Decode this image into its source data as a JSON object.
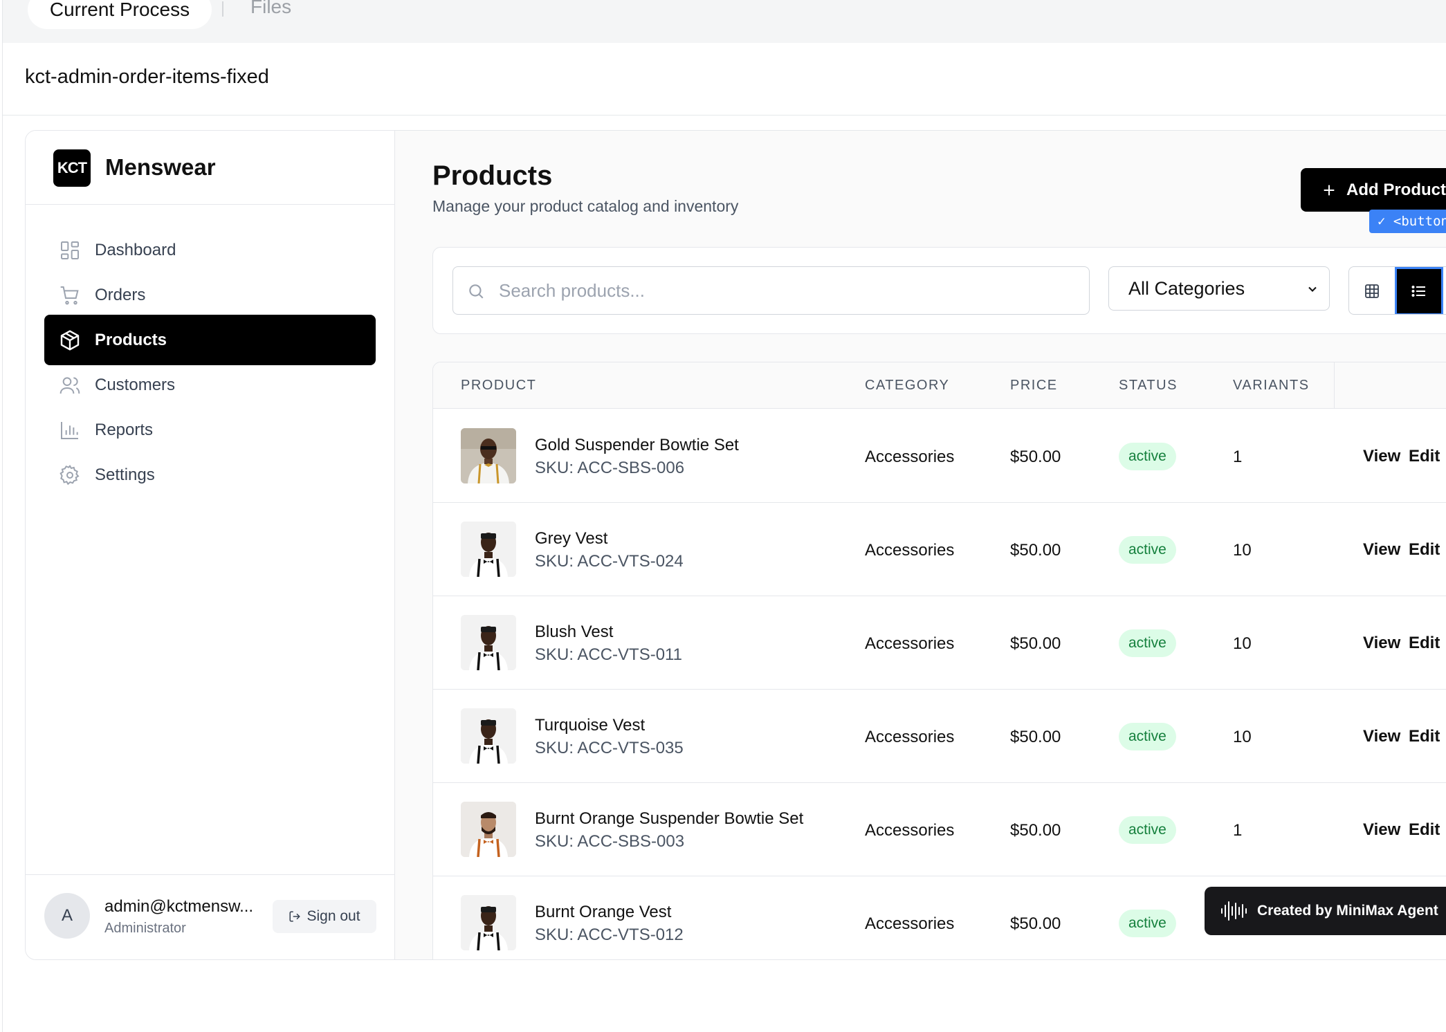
{
  "tabs": {
    "current": "Current Process",
    "files": "Files"
  },
  "process_title": "kct-admin-order-items-fixed",
  "brand": {
    "logo_text": "KCT",
    "name": "Menswear"
  },
  "nav": [
    {
      "label": "Dashboard",
      "icon": "dashboard-icon",
      "active": false
    },
    {
      "label": "Orders",
      "icon": "cart-icon",
      "active": false
    },
    {
      "label": "Products",
      "icon": "package-icon",
      "active": true
    },
    {
      "label": "Customers",
      "icon": "users-icon",
      "active": false
    },
    {
      "label": "Reports",
      "icon": "bar-chart-icon",
      "active": false
    },
    {
      "label": "Settings",
      "icon": "gear-icon",
      "active": false
    }
  ],
  "user": {
    "initial": "A",
    "email": "admin@kctmensw...",
    "role": "Administrator",
    "signout_label": "Sign out"
  },
  "header": {
    "title": "Products",
    "subtitle": "Manage your product catalog and inventory",
    "add_label": "Add Product"
  },
  "filters": {
    "search_placeholder": "Search products...",
    "category_selected": "All Categories",
    "picker_tag": "✓ <button"
  },
  "table": {
    "columns": [
      "PRODUCT",
      "CATEGORY",
      "PRICE",
      "STATUS",
      "VARIANTS"
    ],
    "rows": [
      {
        "name": "Gold Suspender Bowtie Set",
        "sku": "SKU: ACC-SBS-006",
        "category": "Accessories",
        "price": "$50.00",
        "status": "active",
        "variants": "1",
        "view": "View",
        "edit": "Edit"
      },
      {
        "name": "Grey Vest",
        "sku": "SKU: ACC-VTS-024",
        "category": "Accessories",
        "price": "$50.00",
        "status": "active",
        "variants": "10",
        "view": "View",
        "edit": "Edit"
      },
      {
        "name": "Blush Vest",
        "sku": "SKU: ACC-VTS-011",
        "category": "Accessories",
        "price": "$50.00",
        "status": "active",
        "variants": "10",
        "view": "View",
        "edit": "Edit"
      },
      {
        "name": "Turquoise Vest",
        "sku": "SKU: ACC-VTS-035",
        "category": "Accessories",
        "price": "$50.00",
        "status": "active",
        "variants": "10",
        "view": "View",
        "edit": "Edit"
      },
      {
        "name": "Burnt Orange Suspender Bowtie Set",
        "sku": "SKU: ACC-SBS-003",
        "category": "Accessories",
        "price": "$50.00",
        "status": "active",
        "variants": "1",
        "view": "View",
        "edit": "Edit"
      },
      {
        "name": "Burnt Orange Vest",
        "sku": "SKU: ACC-VTS-012",
        "category": "Accessories",
        "price": "$50.00",
        "status": "active",
        "variants": "",
        "view": "",
        "edit": ""
      }
    ]
  },
  "toast": {
    "label": "Created by MiniMax Agent"
  },
  "colors": {
    "accent": "#000000",
    "badge_bg": "#dcfce7",
    "badge_text": "#15803d",
    "selection": "#3b82f6"
  }
}
